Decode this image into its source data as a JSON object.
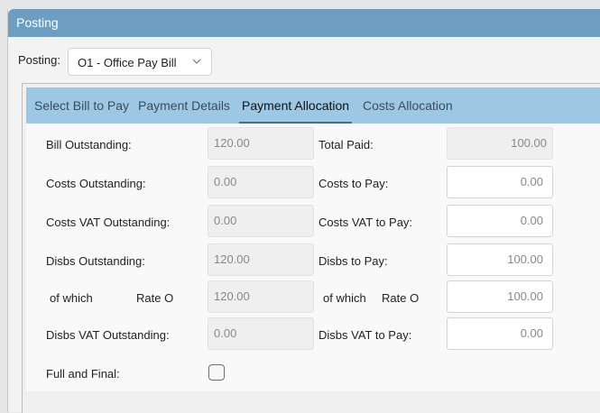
{
  "window": {
    "title": "Posting"
  },
  "posting": {
    "label": "Posting:",
    "selected": "O1 - Office Pay Bill"
  },
  "tabs": [
    {
      "label": "Select Bill to Pay"
    },
    {
      "label": "Payment Details"
    },
    {
      "label": "Payment Allocation"
    },
    {
      "label": "Costs Allocation"
    }
  ],
  "active_tab": "Payment Allocation",
  "form": {
    "bill_outstanding": {
      "label": "Bill Outstanding:",
      "value": "120.00"
    },
    "total_paid": {
      "label": "Total Paid:",
      "value": "100.00"
    },
    "costs_outstanding": {
      "label": "Costs Outstanding:",
      "value": "0.00"
    },
    "costs_to_pay": {
      "label": "Costs to Pay:",
      "value": "0.00"
    },
    "costs_vat_outstanding": {
      "label": "Costs VAT Outstanding:",
      "value": "0.00"
    },
    "costs_vat_to_pay": {
      "label": "Costs VAT to Pay:",
      "value": "0.00"
    },
    "disbs_outstanding": {
      "label": "Disbs Outstanding:",
      "value": "120.00"
    },
    "disbs_to_pay": {
      "label": "Disbs to Pay:",
      "value": "100.00"
    },
    "of_which_left": {
      "label": "of which",
      "rate": "Rate O",
      "value": "120.00"
    },
    "of_which_right": {
      "label": "of which",
      "rate": "Rate O",
      "value": "100.00"
    },
    "disbs_vat_outstanding": {
      "label": "Disbs VAT Outstanding:",
      "value": "0.00"
    },
    "disbs_vat_to_pay": {
      "label": "Disbs VAT to Pay:",
      "value": "0.00"
    },
    "full_and_final": {
      "label": "Full and Final:",
      "checked": false
    }
  },
  "icons": {
    "dropdown": "chevron-down-icon"
  }
}
